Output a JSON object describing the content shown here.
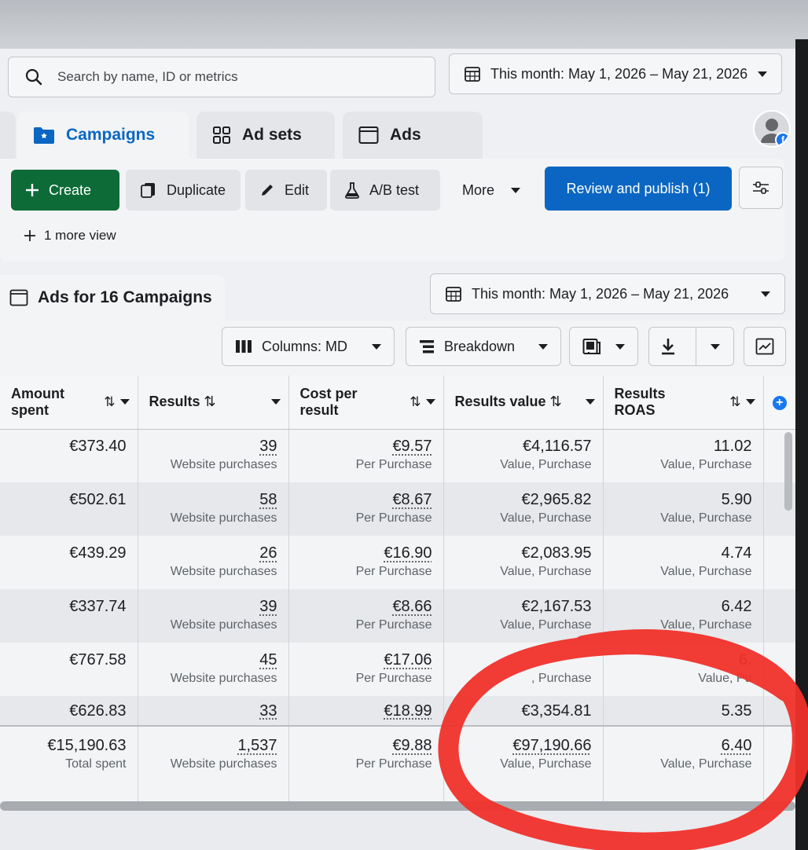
{
  "search": {
    "placeholder": "Search by name, ID or metrics"
  },
  "date_range_label": "This month: May 1, 2026 – May 21, 2026",
  "tabs": [
    {
      "label": "Campaigns",
      "active": true
    },
    {
      "label": "Ad sets",
      "active": false
    },
    {
      "label": "Ads",
      "active": false
    }
  ],
  "toolbar": {
    "create": "Create",
    "duplicate": "Duplicate",
    "edit": "Edit",
    "ab_test": "A/B test",
    "more": "More",
    "review": "Review and publish (1)",
    "more_view": "1 more view"
  },
  "table_section": {
    "title": "Ads for 16 Campaigns",
    "columns_button": "Columns: MD",
    "breakdown_button": "Breakdown"
  },
  "columns": [
    {
      "label": "Amount spent"
    },
    {
      "label": "Results"
    },
    {
      "label": "Cost per result"
    },
    {
      "label": "Results value"
    },
    {
      "label": "Results ROAS"
    }
  ],
  "rows": [
    {
      "spent": "€373.40",
      "results": "39",
      "results_sub": "Website purchases",
      "cpr": "€9.57",
      "cpr_sub": "Per Purchase",
      "value": "€4,116.57",
      "value_sub": "Value, Purchase",
      "roas": "11.02",
      "roas_sub": "Value, Purchase"
    },
    {
      "spent": "€502.61",
      "results": "58",
      "results_sub": "Website purchases",
      "cpr": "€8.67",
      "cpr_sub": "Per Purchase",
      "value": "€2,965.82",
      "value_sub": "Value, Purchase",
      "roas": "5.90",
      "roas_sub": "Value, Purchase"
    },
    {
      "spent": "€439.29",
      "results": "26",
      "results_sub": "Website purchases",
      "cpr": "€16.90",
      "cpr_sub": "Per Purchase",
      "value": "€2,083.95",
      "value_sub": "Value, Purchase",
      "roas": "4.74",
      "roas_sub": "Value, Purchase"
    },
    {
      "spent": "€337.74",
      "results": "39",
      "results_sub": "Website purchases",
      "cpr": "€8.66",
      "cpr_sub": "Per Purchase",
      "value": "€2,167.53",
      "value_sub": "Value, Purchase",
      "roas": "6.42",
      "roas_sub": "Value, Purchase"
    },
    {
      "spent": "€767.58",
      "results": "45",
      "results_sub": "Website purchases",
      "cpr": "€17.06",
      "cpr_sub": "Per Purchase",
      "value": "",
      "value_sub": ", Purchase",
      "roas": "6.",
      "roas_sub": "Value, Pu"
    },
    {
      "spent": "€626.83",
      "results": "33",
      "cpr": "€18.99",
      "value": "€3,354.81",
      "roas": "5.35"
    }
  ],
  "totals": {
    "spent": "€15,190.63",
    "spent_sub": "Total spent",
    "results": "1,537",
    "results_sub": "Website purchases",
    "cpr": "€9.88",
    "cpr_sub": "Per Purchase",
    "value": "€97,190.66",
    "value_sub": "Value, Purchase",
    "roas": "6.40",
    "roas_sub": "Value, Purchase"
  },
  "colors": {
    "primary": "#0a66c2",
    "create": "#0c6b36",
    "annotation": "#f0302a"
  }
}
